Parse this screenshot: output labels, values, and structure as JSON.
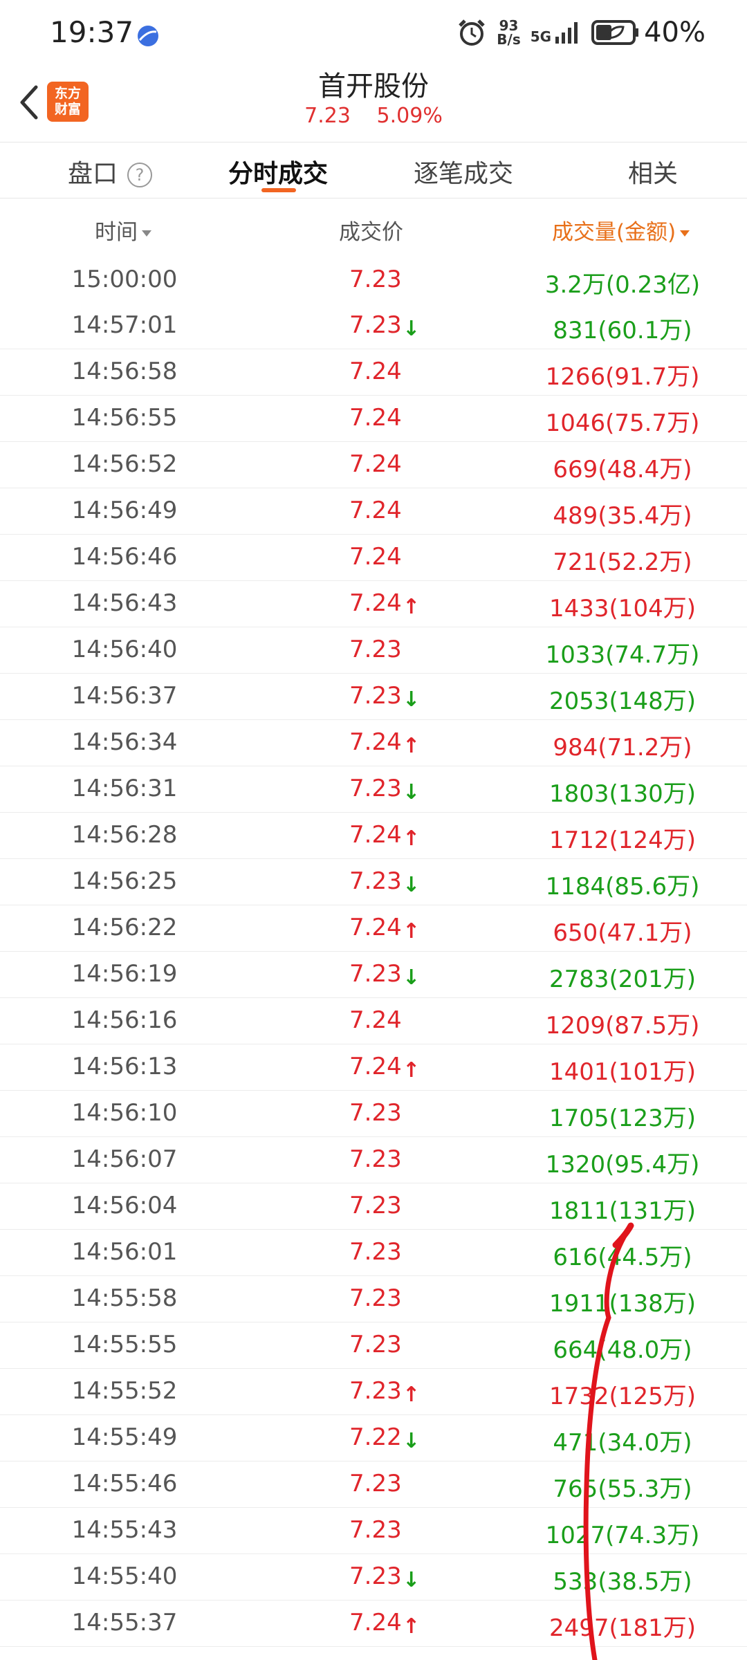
{
  "status_bar": {
    "time": "19:37",
    "net_speed_value": "93",
    "net_speed_unit": "B/s",
    "network": "5G",
    "battery": "40%"
  },
  "header": {
    "back_icon": "back-icon",
    "logo_text_line1": "东方",
    "logo_text_line2": "财富",
    "title": "首开股份",
    "price": "7.23",
    "change_pct": "5.09%"
  },
  "tabs": {
    "panko": "盘口",
    "help": "?",
    "intraday": "分时成交",
    "tick": "逐笔成交",
    "related": "相关"
  },
  "columns": {
    "time": "时间",
    "price": "成交价",
    "volume": "成交量(金额)"
  },
  "colors": {
    "accent": "#f26522",
    "up": "#e0252b",
    "down": "#1a9e1a"
  },
  "trades": [
    {
      "time": "15:00:00",
      "price": "7.23",
      "arrow": "",
      "vol": "3.2万(0.23亿)",
      "side": "green"
    },
    {
      "time": "14:57:01",
      "price": "7.23",
      "arrow": "down",
      "vol": "831(60.1万)",
      "side": "green"
    },
    {
      "time": "14:56:58",
      "price": "7.24",
      "arrow": "",
      "vol": "1266(91.7万)",
      "side": "red"
    },
    {
      "time": "14:56:55",
      "price": "7.24",
      "arrow": "",
      "vol": "1046(75.7万)",
      "side": "red"
    },
    {
      "time": "14:56:52",
      "price": "7.24",
      "arrow": "",
      "vol": "669(48.4万)",
      "side": "red"
    },
    {
      "time": "14:56:49",
      "price": "7.24",
      "arrow": "",
      "vol": "489(35.4万)",
      "side": "red"
    },
    {
      "time": "14:56:46",
      "price": "7.24",
      "arrow": "",
      "vol": "721(52.2万)",
      "side": "red"
    },
    {
      "time": "14:56:43",
      "price": "7.24",
      "arrow": "up",
      "vol": "1433(104万)",
      "side": "red"
    },
    {
      "time": "14:56:40",
      "price": "7.23",
      "arrow": "",
      "vol": "1033(74.7万)",
      "side": "green"
    },
    {
      "time": "14:56:37",
      "price": "7.23",
      "arrow": "down",
      "vol": "2053(148万)",
      "side": "green"
    },
    {
      "time": "14:56:34",
      "price": "7.24",
      "arrow": "up",
      "vol": "984(71.2万)",
      "side": "red"
    },
    {
      "time": "14:56:31",
      "price": "7.23",
      "arrow": "down",
      "vol": "1803(130万)",
      "side": "green"
    },
    {
      "time": "14:56:28",
      "price": "7.24",
      "arrow": "up",
      "vol": "1712(124万)",
      "side": "red"
    },
    {
      "time": "14:56:25",
      "price": "7.23",
      "arrow": "down",
      "vol": "1184(85.6万)",
      "side": "green"
    },
    {
      "time": "14:56:22",
      "price": "7.24",
      "arrow": "up",
      "vol": "650(47.1万)",
      "side": "red"
    },
    {
      "time": "14:56:19",
      "price": "7.23",
      "arrow": "down",
      "vol": "2783(201万)",
      "side": "green"
    },
    {
      "time": "14:56:16",
      "price": "7.24",
      "arrow": "",
      "vol": "1209(87.5万)",
      "side": "red"
    },
    {
      "time": "14:56:13",
      "price": "7.24",
      "arrow": "up",
      "vol": "1401(101万)",
      "side": "red"
    },
    {
      "time": "14:56:10",
      "price": "7.23",
      "arrow": "",
      "vol": "1705(123万)",
      "side": "green"
    },
    {
      "time": "14:56:07",
      "price": "7.23",
      "arrow": "",
      "vol": "1320(95.4万)",
      "side": "green"
    },
    {
      "time": "14:56:04",
      "price": "7.23",
      "arrow": "",
      "vol": "1811(131万)",
      "side": "green"
    },
    {
      "time": "14:56:01",
      "price": "7.23",
      "arrow": "",
      "vol": "616(44.5万)",
      "side": "green"
    },
    {
      "time": "14:55:58",
      "price": "7.23",
      "arrow": "",
      "vol": "1911(138万)",
      "side": "green"
    },
    {
      "time": "14:55:55",
      "price": "7.23",
      "arrow": "",
      "vol": "664(48.0万)",
      "side": "green"
    },
    {
      "time": "14:55:52",
      "price": "7.23",
      "arrow": "up",
      "vol": "1732(125万)",
      "side": "red"
    },
    {
      "time": "14:55:49",
      "price": "7.22",
      "arrow": "down",
      "vol": "471(34.0万)",
      "side": "green"
    },
    {
      "time": "14:55:46",
      "price": "7.23",
      "arrow": "",
      "vol": "765(55.3万)",
      "side": "green"
    },
    {
      "time": "14:55:43",
      "price": "7.23",
      "arrow": "",
      "vol": "1027(74.3万)",
      "side": "green"
    },
    {
      "time": "14:55:40",
      "price": "7.23",
      "arrow": "down",
      "vol": "533(38.5万)",
      "side": "green"
    },
    {
      "time": "14:55:37",
      "price": "7.24",
      "arrow": "up",
      "vol": "2497(181万)",
      "side": "red"
    }
  ]
}
